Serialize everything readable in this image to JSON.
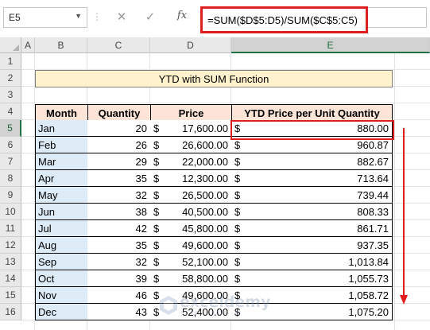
{
  "formula_bar": {
    "name_box": "E5",
    "cancel_icon": "✕",
    "enter_icon": "✓",
    "fx_icon": "fx",
    "formula": "=SUM($D$5:D5)/SUM($C$5:C5)"
  },
  "columns": [
    "A",
    "B",
    "C",
    "D",
    "E"
  ],
  "rows": [
    "1",
    "2",
    "3",
    "4",
    "5",
    "6",
    "7",
    "8",
    "9",
    "10",
    "11",
    "12",
    "13",
    "14",
    "15",
    "16"
  ],
  "title": "YTD with SUM Function",
  "headers": {
    "month": "Month",
    "quantity": "Quantity",
    "price": "Price",
    "ytd": "YTD Price per Unit Quantity"
  },
  "currency_symbol": "$",
  "table": [
    {
      "month": "Jan",
      "quantity": "20",
      "price": "17,600.00",
      "ytd": "880.00"
    },
    {
      "month": "Feb",
      "quantity": "26",
      "price": "26,600.00",
      "ytd": "960.87"
    },
    {
      "month": "Mar",
      "quantity": "29",
      "price": "22,000.00",
      "ytd": "882.67"
    },
    {
      "month": "Apr",
      "quantity": "35",
      "price": "12,300.00",
      "ytd": "713.64"
    },
    {
      "month": "May",
      "quantity": "32",
      "price": "26,500.00",
      "ytd": "739.44"
    },
    {
      "month": "Jun",
      "quantity": "38",
      "price": "40,500.00",
      "ytd": "808.33"
    },
    {
      "month": "Jul",
      "quantity": "42",
      "price": "45,800.00",
      "ytd": "861.71"
    },
    {
      "month": "Aug",
      "quantity": "35",
      "price": "49,600.00",
      "ytd": "937.35"
    },
    {
      "month": "Sep",
      "quantity": "32",
      "price": "52,100.00",
      "ytd": "1,013.84"
    },
    {
      "month": "Oct",
      "quantity": "39",
      "price": "58,800.00",
      "ytd": "1,055.73"
    },
    {
      "month": "Nov",
      "quantity": "46",
      "price": "49,600.00",
      "ytd": "1,058.72"
    },
    {
      "month": "Dec",
      "quantity": "43",
      "price": "52,400.00",
      "ytd": "1,075.20"
    }
  ],
  "watermark": {
    "name": "exceldemy",
    "tagline": "EXCEL · DATA · BI"
  },
  "colors": {
    "highlight": "#e01e1e",
    "title_fill": "#fff2cc",
    "header_fill": "#fce4d6",
    "month_fill": "#ddebf7",
    "selection_green": "#217346"
  }
}
